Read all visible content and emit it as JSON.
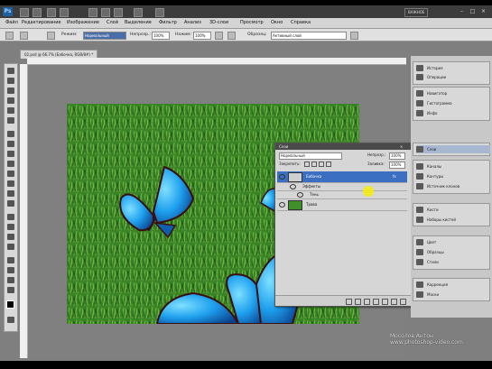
{
  "app": {
    "logo": "Ps",
    "workspace": "ВАЖНОЕ"
  },
  "menu": [
    "Файл",
    "Редактирование",
    "Изображение",
    "Слой",
    "Выделение",
    "Фильтр",
    "Анализ",
    "3D-слои",
    "Просмотр",
    "Окно",
    "Справка"
  ],
  "options": {
    "mode_label": "Режим:",
    "mode_value": "Нормальный",
    "opacity_label": "Непрозр.:",
    "opacity_value": "100%",
    "flow_label": "Нажим:",
    "flow_value": "100%",
    "sample_label": "Образец:",
    "sample_value": "Активный слой"
  },
  "document": {
    "tab": "02.psd @ 66.7% (Бабочка, RGB/8#) *"
  },
  "layers_panel": {
    "title": "Слои",
    "blend_mode": "Нормальный",
    "opacity_label": "Непрозр.:",
    "opacity_value": "100%",
    "lock_label": "Закрепить:",
    "fill_label": "Заливка:",
    "fill_value": "100%",
    "layers": [
      {
        "name": "Бабочка",
        "selected": true,
        "fx": "fx"
      },
      {
        "name": "Эффекты",
        "sub": true
      },
      {
        "name": "Тень",
        "sub2": true
      },
      {
        "name": "Трава",
        "selected": false
      }
    ]
  },
  "dock": {
    "group1": [
      "История",
      "Операции"
    ],
    "group2": [
      "Навигатор",
      "Гистограмма",
      "Инфо"
    ],
    "group3": [
      "Слои"
    ],
    "group4": [
      "Каналы",
      "Контуры",
      "Источник клонов"
    ],
    "group5": [
      "Кисти",
      "Наборы кистей"
    ],
    "group6": [
      "Цвет",
      "Образцы",
      "Стили"
    ],
    "group7": [
      "Коррекция",
      "Маски"
    ]
  },
  "watermark": {
    "line1": "Мосолов Антон",
    "line2": "www.photoshop-video.com"
  },
  "colors": {
    "grass": "#3f8f2a",
    "butterfly": "#1ea0ee",
    "highlight": "#f2ec18"
  }
}
